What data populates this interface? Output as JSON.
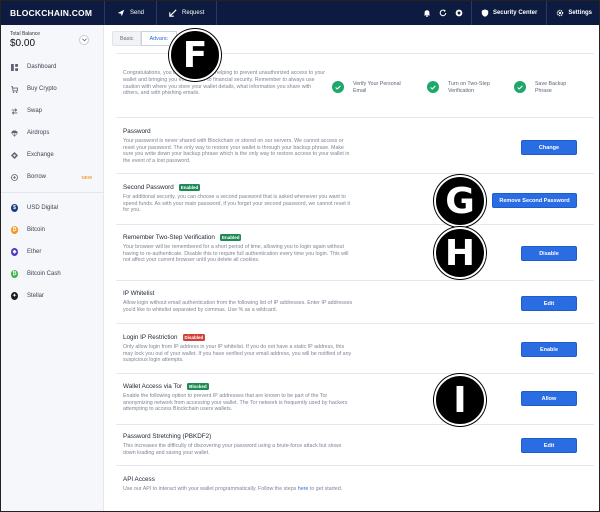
{
  "topbar": {
    "logo": "BLOCKCHAIN.COM",
    "send": "Send",
    "request": "Request",
    "security_center": "Security Center",
    "settings": "Settings"
  },
  "sidebar": {
    "balance_label": "Total Balance",
    "balance_amount": "$0.00",
    "nav": [
      {
        "label": "Dashboard",
        "icon": "dashboard-icon"
      },
      {
        "label": "Buy Crypto",
        "icon": "cart-icon"
      },
      {
        "label": "Swap",
        "icon": "swap-icon"
      },
      {
        "label": "Airdrops",
        "icon": "parachute-icon"
      },
      {
        "label": "Exchange",
        "icon": "exchange-icon"
      },
      {
        "label": "Borrow",
        "icon": "borrow-icon",
        "badge": "NEW"
      }
    ],
    "wallets": [
      {
        "label": "USD Digital",
        "color": "#1a3b86"
      },
      {
        "label": "Bitcoin",
        "color": "#f7931a"
      },
      {
        "label": "Ether",
        "color": "#473bcb"
      },
      {
        "label": "Bitcoin Cash",
        "color": "#3cb04a"
      },
      {
        "label": "Stellar",
        "color": "#1b1b1b"
      }
    ]
  },
  "tabs": {
    "basic": "Basic",
    "advanced": "Advanc"
  },
  "intro": {
    "text": "Congratulations, you            the initial steps in helping to prevent unauthorized access to your wallet and bringing you even closer to financial security. Remember to always use caution with where you store your wallet details, what information you share with others, and with phishing emails.",
    "steps": [
      "Verify Your Personal Email",
      "Turn on Two-Step Verification",
      "Save Backup Phrase"
    ]
  },
  "sections": [
    {
      "title": "Password",
      "badge": "",
      "desc": "Your password is never shared with Blockchain or stored on our servers. We cannot access or reset your password. The only way to restore your wallet is through your backup phrase. Make sure you write down your backup phrase which is the only way to restore access to your wallet in the event of a lost password.",
      "button": "Change"
    },
    {
      "title": "Second Password",
      "badge": "Enabled",
      "desc": "For additional security, you can choose a second password that is asked whenever you want to spend funds. As with your main password, if you forget your second password, we cannot reset it for you.",
      "button": "Remove Second Password"
    },
    {
      "title": "Remember Two-Step Verification",
      "badge": "Enabled",
      "desc": "Your browser will be remembered for a short period of time, allowing you to login again without having to re-authenticate. Disable this to require full authentication every time you login. This will not affect your current browser until you delete all cookies.",
      "button": "Disable"
    },
    {
      "title": "IP Whitelist",
      "badge": "",
      "desc": "Allow login without email authentication from the following list of IP addresses. Enter IP addresses you'd like to whitelist separated by commas. Use % as a wildcard.",
      "button": "Edit"
    },
    {
      "title": "Login IP Restriction",
      "badge": "Disabled",
      "desc": "Only allow login from IP address in your IP whitelist. If you do not have a static IP address, this may lock you out of your wallet. If you have verified your email address, you will be notified of any suspicious login attempts.",
      "button": "Enable"
    },
    {
      "title": "Wallet Access via Tor",
      "badge": "Blocked",
      "desc": "Enable the following option to prevent IP addresses that are known to be part of the Tor anonymizing network from accessing your wallet. The Tor network is frequently used by hackers attempting to access Blockchain users wallets.",
      "button": "Allow"
    },
    {
      "title": "Password Stretching (PBKDF2)",
      "badge": "",
      "desc": "This increases the difficulty of discovering your password using a brute-force attack but slows down loading and saving your wallet.",
      "button": "Edit"
    },
    {
      "title": "API Access",
      "badge": "",
      "desc_pre": "Use our API to interact with your wallet programmatically. Follow the steps ",
      "desc_link": "here",
      "desc_post": " to get started.",
      "button": ""
    }
  ],
  "markers": [
    "F",
    "G",
    "H",
    "I"
  ],
  "colors": {
    "topbar": "#0c1b3f",
    "accent": "#2a6de2",
    "success": "#1ea76a",
    "enabled_badge": "#1e8a55",
    "disabled_badge": "#d2403a",
    "blocked_badge": "#1e8a55"
  }
}
